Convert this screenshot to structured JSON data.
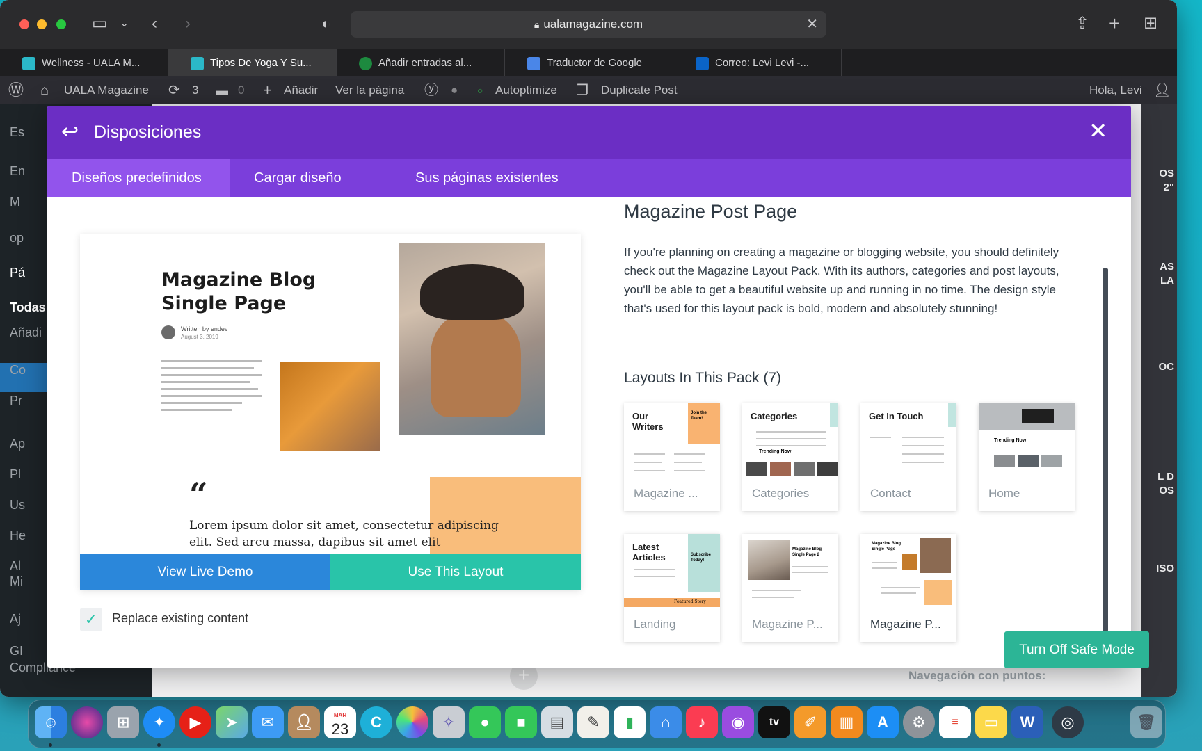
{
  "browser": {
    "url": "ualamagazine.com",
    "tabs": [
      {
        "label": "Wellness - UALA M...",
        "active": false
      },
      {
        "label": "Tipos De Yoga Y Su...",
        "active": true
      },
      {
        "label": "Añadir entradas al...",
        "active": false
      },
      {
        "label": "Traductor de Google",
        "active": false
      },
      {
        "label": "Correo: Levi Levi -...",
        "active": false
      }
    ]
  },
  "adminbar": {
    "site": "UALA Magazine",
    "updates": "3",
    "comments": "0",
    "add": "Añadir",
    "view": "Ver la página",
    "autoptimize": "Autoptimize",
    "duplicate": "Duplicate Post",
    "greeting": "Hola, Levi"
  },
  "wp_sidebar": {
    "items": [
      "Es",
      "En",
      "M",
      "op",
      "Pá",
      "Todas",
      "Añadi",
      "Co",
      "Pr",
      "Ap",
      "Pl",
      "Us",
      "He",
      "Al",
      "Mi",
      "Aj",
      "GI",
      "Compliance"
    ]
  },
  "wp_right": {
    "edge_labels": [
      "OS",
      "2\"",
      "AS",
      "LA",
      "OC",
      "L D",
      "OS",
      "ISO"
    ],
    "nav_label": "Navegación con puntos:"
  },
  "modal": {
    "title": "Disposiciones",
    "tabs": [
      "Diseños predefinidos",
      "Cargar diseño",
      "Sus páginas existentes"
    ],
    "active_tab": 0,
    "preview": {
      "title": "Magazine Blog Single Page",
      "author": "Written by endev",
      "date": "August 3, 2019",
      "quote_mark": "“",
      "lorem": "Lorem ipsum dolor sit amet, consectetur adipiscing elit. Sed arcu massa, dapibus sit amet elit"
    },
    "view_demo": "View Live Demo",
    "use_layout": "Use This Layout",
    "replace_label": "Replace existing content",
    "replace_checked": true,
    "detail": {
      "title": "Magazine Post Page",
      "description": "If you're planning on creating a magazine or blogging website, you should definitely check out the Magazine Layout Pack. With its authors, categories and post layouts, you'll be able to get a beautiful website up and running in no time. The design style that's used for this layout pack is bold, modern and absolutely stunning!",
      "pack_title": "Layouts In This Pack (7)"
    },
    "layouts": [
      {
        "label": "Magazine ...",
        "heading": "Our Writers",
        "badge": "Join the Team!",
        "selected": false
      },
      {
        "label": "Categories",
        "heading": "Categories",
        "sub": "Trending Now",
        "selected": false
      },
      {
        "label": "Contact",
        "heading": "Get In Touch",
        "selected": false
      },
      {
        "label": "Home",
        "sub": "Trending Now",
        "selected": false
      },
      {
        "label": "Landing",
        "heading": "Latest Articles",
        "badge": "Subscribe Today!",
        "footer": "Featured Story",
        "selected": false
      },
      {
        "label": "Magazine P...",
        "heading": "Magazine Blog Single Page 2",
        "selected": false
      },
      {
        "label": "Magazine P...",
        "heading": "Magazine Blog Single Page",
        "selected": true
      }
    ]
  },
  "safe_mode": "Turn Off Safe Mode",
  "dock": {
    "calendar_month": "MAR",
    "calendar_day": "23",
    "apps": [
      "finder",
      "siri",
      "launchpad",
      "safari",
      "youtube",
      "maps",
      "mail",
      "contacts",
      "calendar",
      "canva",
      "photos",
      "compass",
      "messages",
      "facetime",
      "preview",
      "textedit",
      "numbers",
      "keynote",
      "music",
      "podcasts",
      "tv",
      "pages",
      "books",
      "app-store",
      "system-preferences",
      "reminders",
      "notes",
      "word",
      "quicktime",
      "trash"
    ]
  },
  "colors": {
    "modal_header": "#6b2ec4",
    "modal_tabs": "#7b3edb",
    "active_tab": "#9254ec",
    "demo_button": "#2b87da",
    "use_button": "#29c4a9",
    "safe_mode": "#2cb596"
  }
}
